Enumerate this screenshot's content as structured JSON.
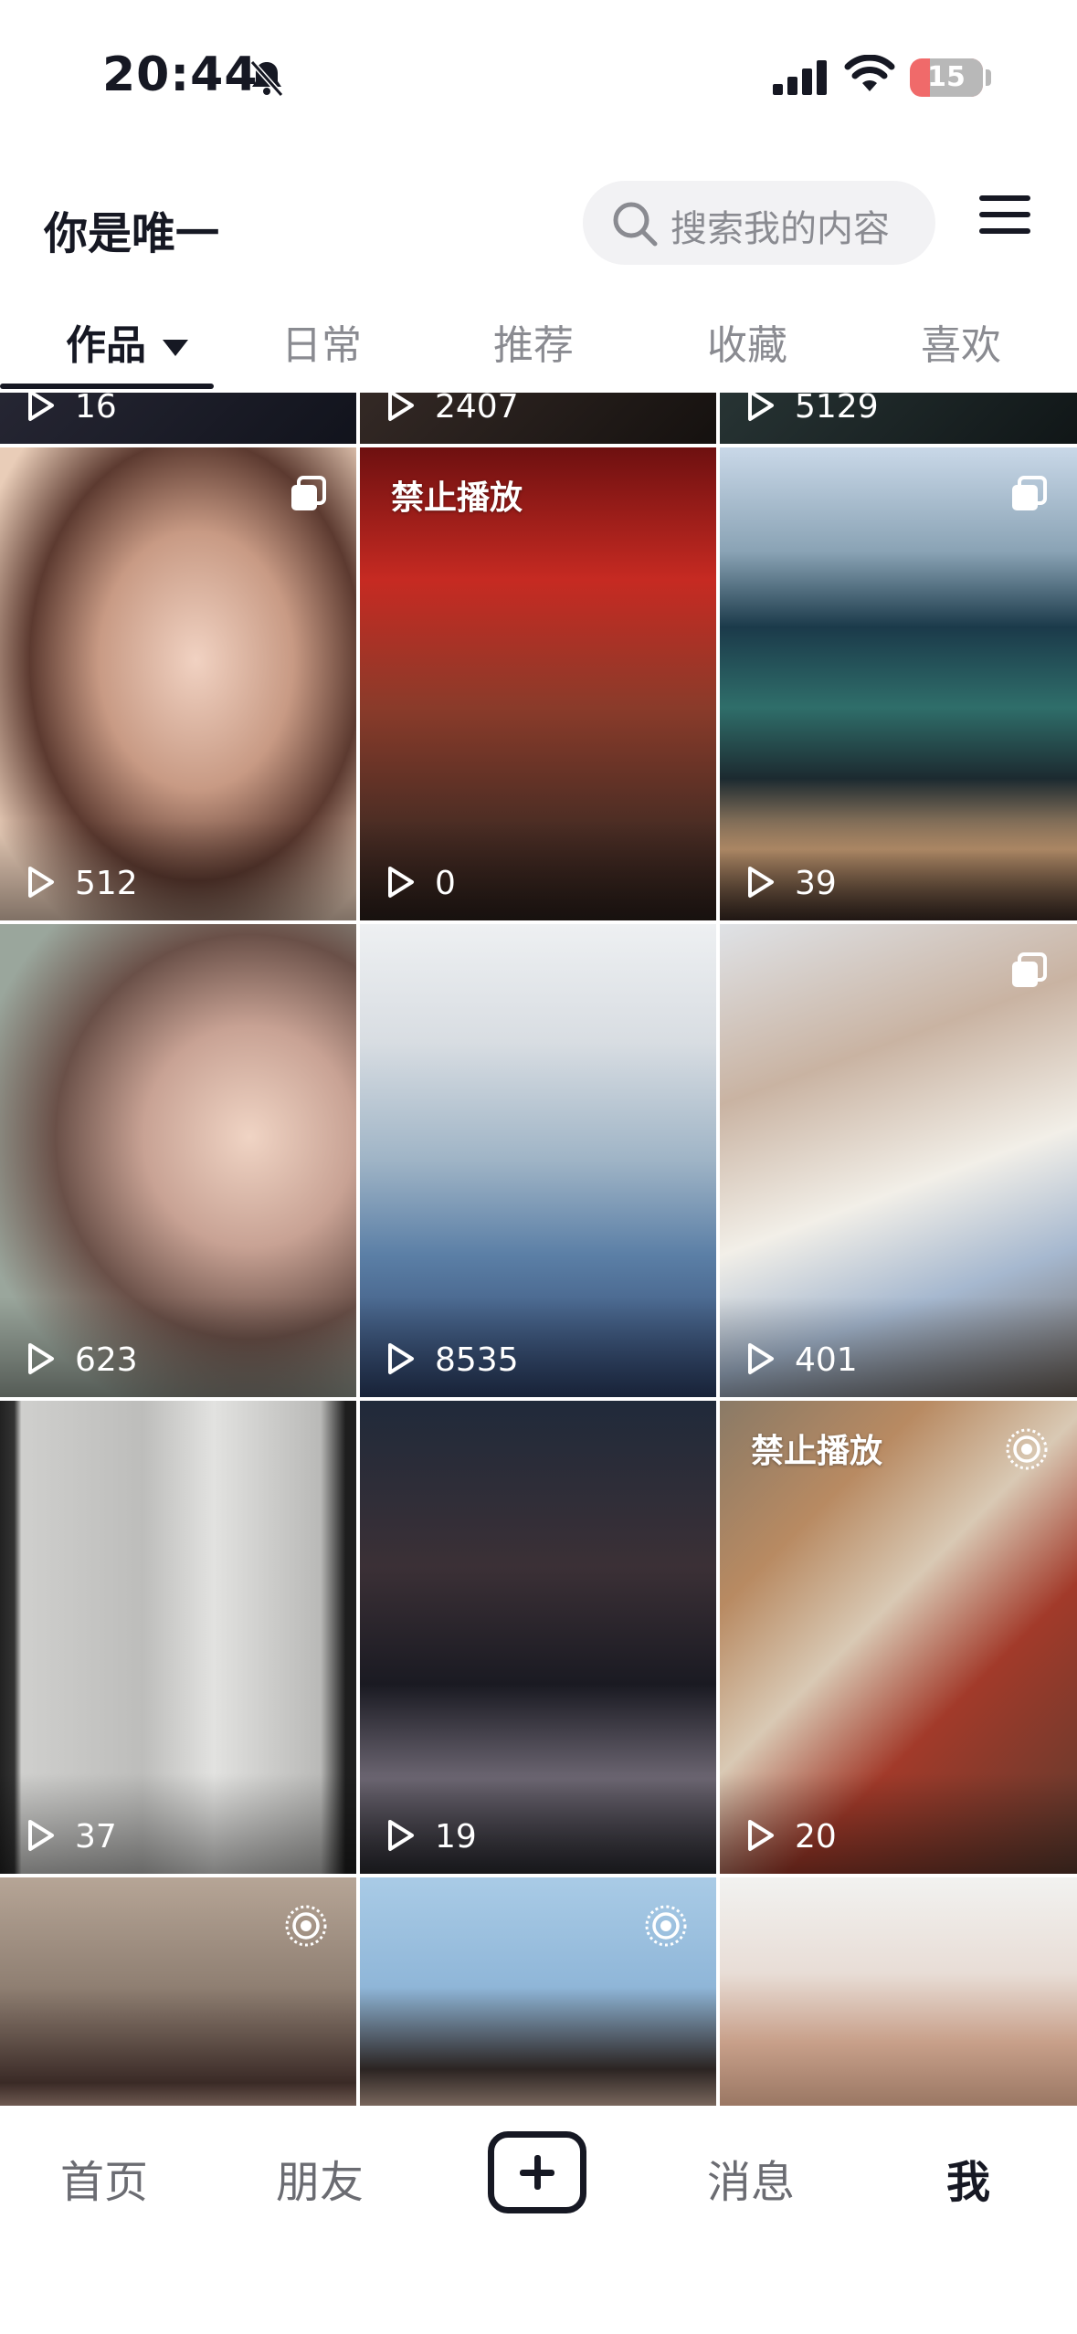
{
  "status_bar": {
    "time": "20:44",
    "battery": "15"
  },
  "header": {
    "profile_name": "你是唯一",
    "search_placeholder": "搜索我的内容"
  },
  "tabs": [
    {
      "label": "作品",
      "active": true
    },
    {
      "label": "日常"
    },
    {
      "label": "推荐"
    },
    {
      "label": "收藏"
    },
    {
      "label": "喜欢"
    }
  ],
  "grid": {
    "partial_row_views": [
      "16",
      "2407",
      "5129"
    ],
    "rows": [
      [
        {
          "views": "512",
          "banned_label": "",
          "corner_icon": "multi-image-icon"
        },
        {
          "views": "0",
          "banned_label": "禁止播放",
          "corner_icon": ""
        },
        {
          "views": "39",
          "banned_label": "",
          "corner_icon": "multi-image-icon"
        }
      ],
      [
        {
          "views": "623",
          "banned_label": "",
          "corner_icon": ""
        },
        {
          "views": "8535",
          "banned_label": "",
          "corner_icon": ""
        },
        {
          "views": "401",
          "banned_label": "",
          "corner_icon": "multi-image-icon"
        }
      ],
      [
        {
          "views": "37",
          "banned_label": "",
          "corner_icon": ""
        },
        {
          "views": "19",
          "banned_label": "",
          "corner_icon": ""
        },
        {
          "views": "20",
          "banned_label": "禁止播放",
          "corner_icon": "live-photo-icon"
        }
      ]
    ]
  },
  "bottom_nav": {
    "items": [
      {
        "label": "首页"
      },
      {
        "label": "朋友"
      },
      {
        "label": "消息"
      },
      {
        "label": "我",
        "active": true
      }
    ]
  }
}
